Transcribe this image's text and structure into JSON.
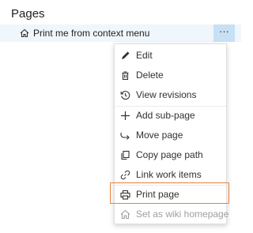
{
  "header": {
    "title": "Pages"
  },
  "page": {
    "label": "Print me from context menu",
    "more_label": "···"
  },
  "menu": {
    "items": [
      {
        "label": "Edit",
        "icon": "edit-icon"
      },
      {
        "label": "Delete",
        "icon": "trash-icon"
      },
      {
        "label": "View revisions",
        "icon": "history-icon"
      },
      {
        "label": "Add sub-page",
        "icon": "plus-icon"
      },
      {
        "label": "Move page",
        "icon": "move-arrow-icon"
      },
      {
        "label": "Copy page path",
        "icon": "copy-icon"
      },
      {
        "label": "Link work items",
        "icon": "link-icon"
      },
      {
        "label": "Print page",
        "icon": "print-icon"
      },
      {
        "label": "Set as wiki homepage",
        "icon": "home-icon",
        "disabled": true
      }
    ]
  },
  "colors": {
    "accent": "#0078d4",
    "highlight_border": "#e8823a",
    "selected_row": "#eff6fc",
    "more_button_bg": "#c7e0f4"
  }
}
